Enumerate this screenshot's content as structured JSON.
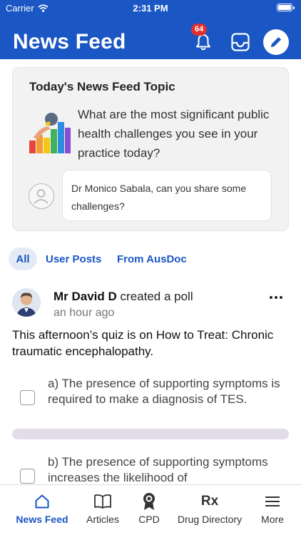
{
  "status_bar": {
    "carrier": "Carrier",
    "time": "2:31 PM"
  },
  "header": {
    "title": "News Feed",
    "notification_count": "64"
  },
  "topic": {
    "heading": "Today's News Feed Topic",
    "question": "What are the most significant public health challenges you see in your practice today?",
    "answer_prompt": "Dr Monico Sabala, can you share some challenges?"
  },
  "tabs": [
    {
      "label": "All",
      "active": true
    },
    {
      "label": "User Posts",
      "active": false
    },
    {
      "label": "From AusDoc",
      "active": false
    }
  ],
  "post": {
    "author": "Mr David D",
    "action": "created a poll",
    "time": "an hour ago",
    "text": "This afternoon’s quiz is on How to Treat: Chronic traumatic encephalopathy.",
    "options": [
      "a) The presence of supporting symptoms is required to make a diagnosis of TES.",
      "b) The presence of supporting symptoms increases the likelihood of"
    ]
  },
  "bottom_nav": [
    {
      "label": "News Feed",
      "icon": "home-icon",
      "active": true
    },
    {
      "label": "Articles",
      "icon": "book-icon",
      "active": false
    },
    {
      "label": "CPD",
      "icon": "award-icon",
      "active": false
    },
    {
      "label": "Drug Directory",
      "icon": "rx-icon",
      "active": false
    },
    {
      "label": "More",
      "icon": "menu-icon",
      "active": false
    }
  ],
  "colors": {
    "brand": "#1a56c4",
    "badge": "#e0302e"
  }
}
